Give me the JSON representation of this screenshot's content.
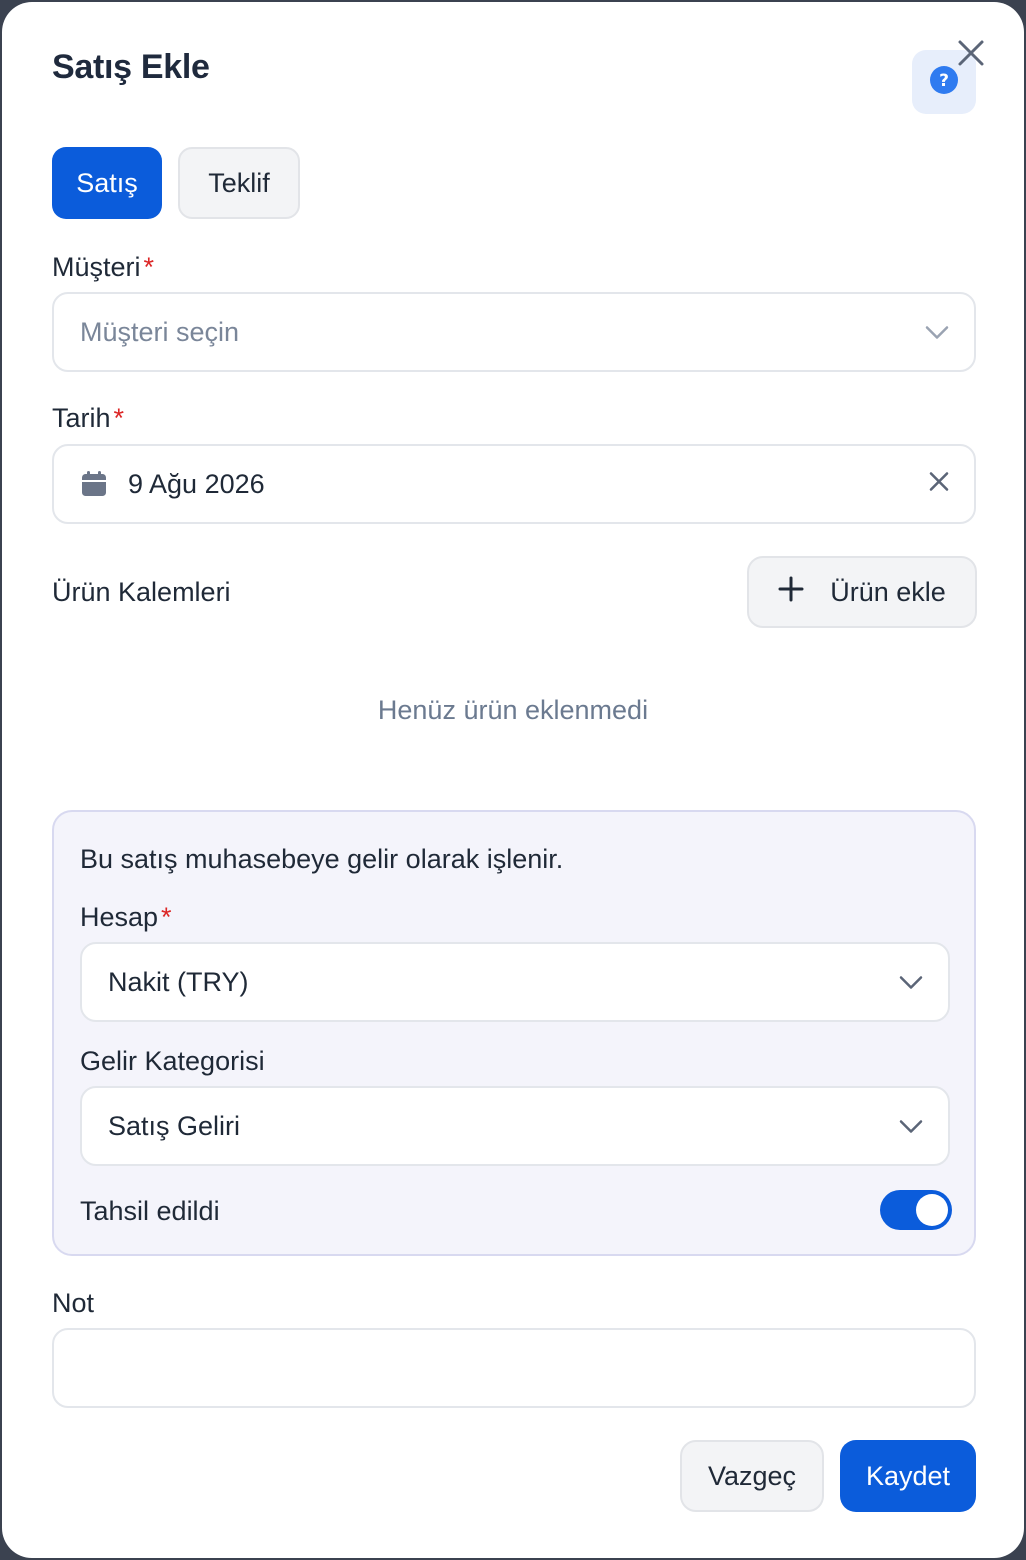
{
  "dialog": {
    "title": "Satış Ekle"
  },
  "tabs": [
    {
      "label": "Satış",
      "active": true
    },
    {
      "label": "Teklif",
      "active": false
    }
  ],
  "customer": {
    "label": "Müşteri",
    "required_mark": "*",
    "placeholder": "Müşteri seçin"
  },
  "date": {
    "label": "Tarih",
    "required_mark": "*",
    "value": "9 Ağu 2026"
  },
  "items": {
    "label": "Ürün Kalemleri",
    "add_label": "Ürün ekle",
    "empty_text": "Henüz ürün eklenmedi"
  },
  "accounting": {
    "info": "Bu satış muhasebeye gelir olarak işlenir.",
    "account": {
      "label": "Hesap",
      "required_mark": "*",
      "value": "Nakit (TRY)"
    },
    "category": {
      "label": "Gelir Kategorisi",
      "value": "Satış Geliri"
    },
    "collected": {
      "label": "Tahsil edildi",
      "on": true
    }
  },
  "note": {
    "label": "Not",
    "value": ""
  },
  "footer": {
    "cancel_label": "Vazgeç",
    "save_label": "Kaydet"
  },
  "colors": {
    "primary": "#0b5cdb",
    "required": "#dc2626",
    "panel_bg": "#f4f4fb",
    "help_bg": "#e7eefb"
  },
  "icons": {
    "close": "close-icon",
    "help": "question-circle-icon",
    "calendar": "calendar-icon",
    "chevron": "chevron-down-icon",
    "clear": "clear-x-icon",
    "plus": "plus-icon"
  }
}
